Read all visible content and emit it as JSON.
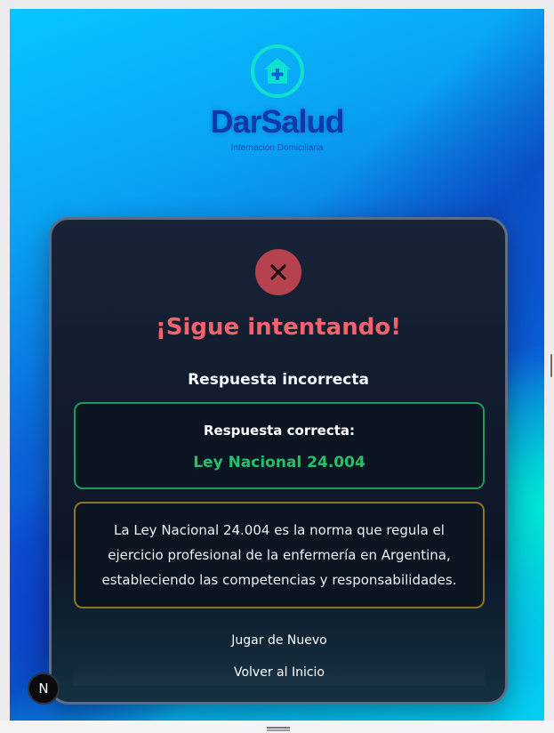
{
  "brand": {
    "name": "DarSalud",
    "tagline": "Internación Domiciliaria",
    "logo_icon": "house-cross-icon",
    "accent_color": "#10e0cf"
  },
  "result": {
    "status_icon": "close-icon",
    "title": "¡Sigue intentando!",
    "subtitle": "Respuesta incorrecta",
    "correct_label": "Respuesta correcta:",
    "correct_answer": "Ley Nacional 24.004",
    "explanation": "La Ley Nacional 24.004 es la norma que regula el ejercicio profesional de la enfermería en Argentina, estableciendo las competencias y responsabilidades."
  },
  "actions": {
    "play_again": "Jugar de Nuevo",
    "back_home": "Volver al Inicio"
  },
  "dev_badge": {
    "label": "N"
  },
  "colors": {
    "error": "#f2636b",
    "success": "#22c26a",
    "warning_border": "#8a7624"
  }
}
